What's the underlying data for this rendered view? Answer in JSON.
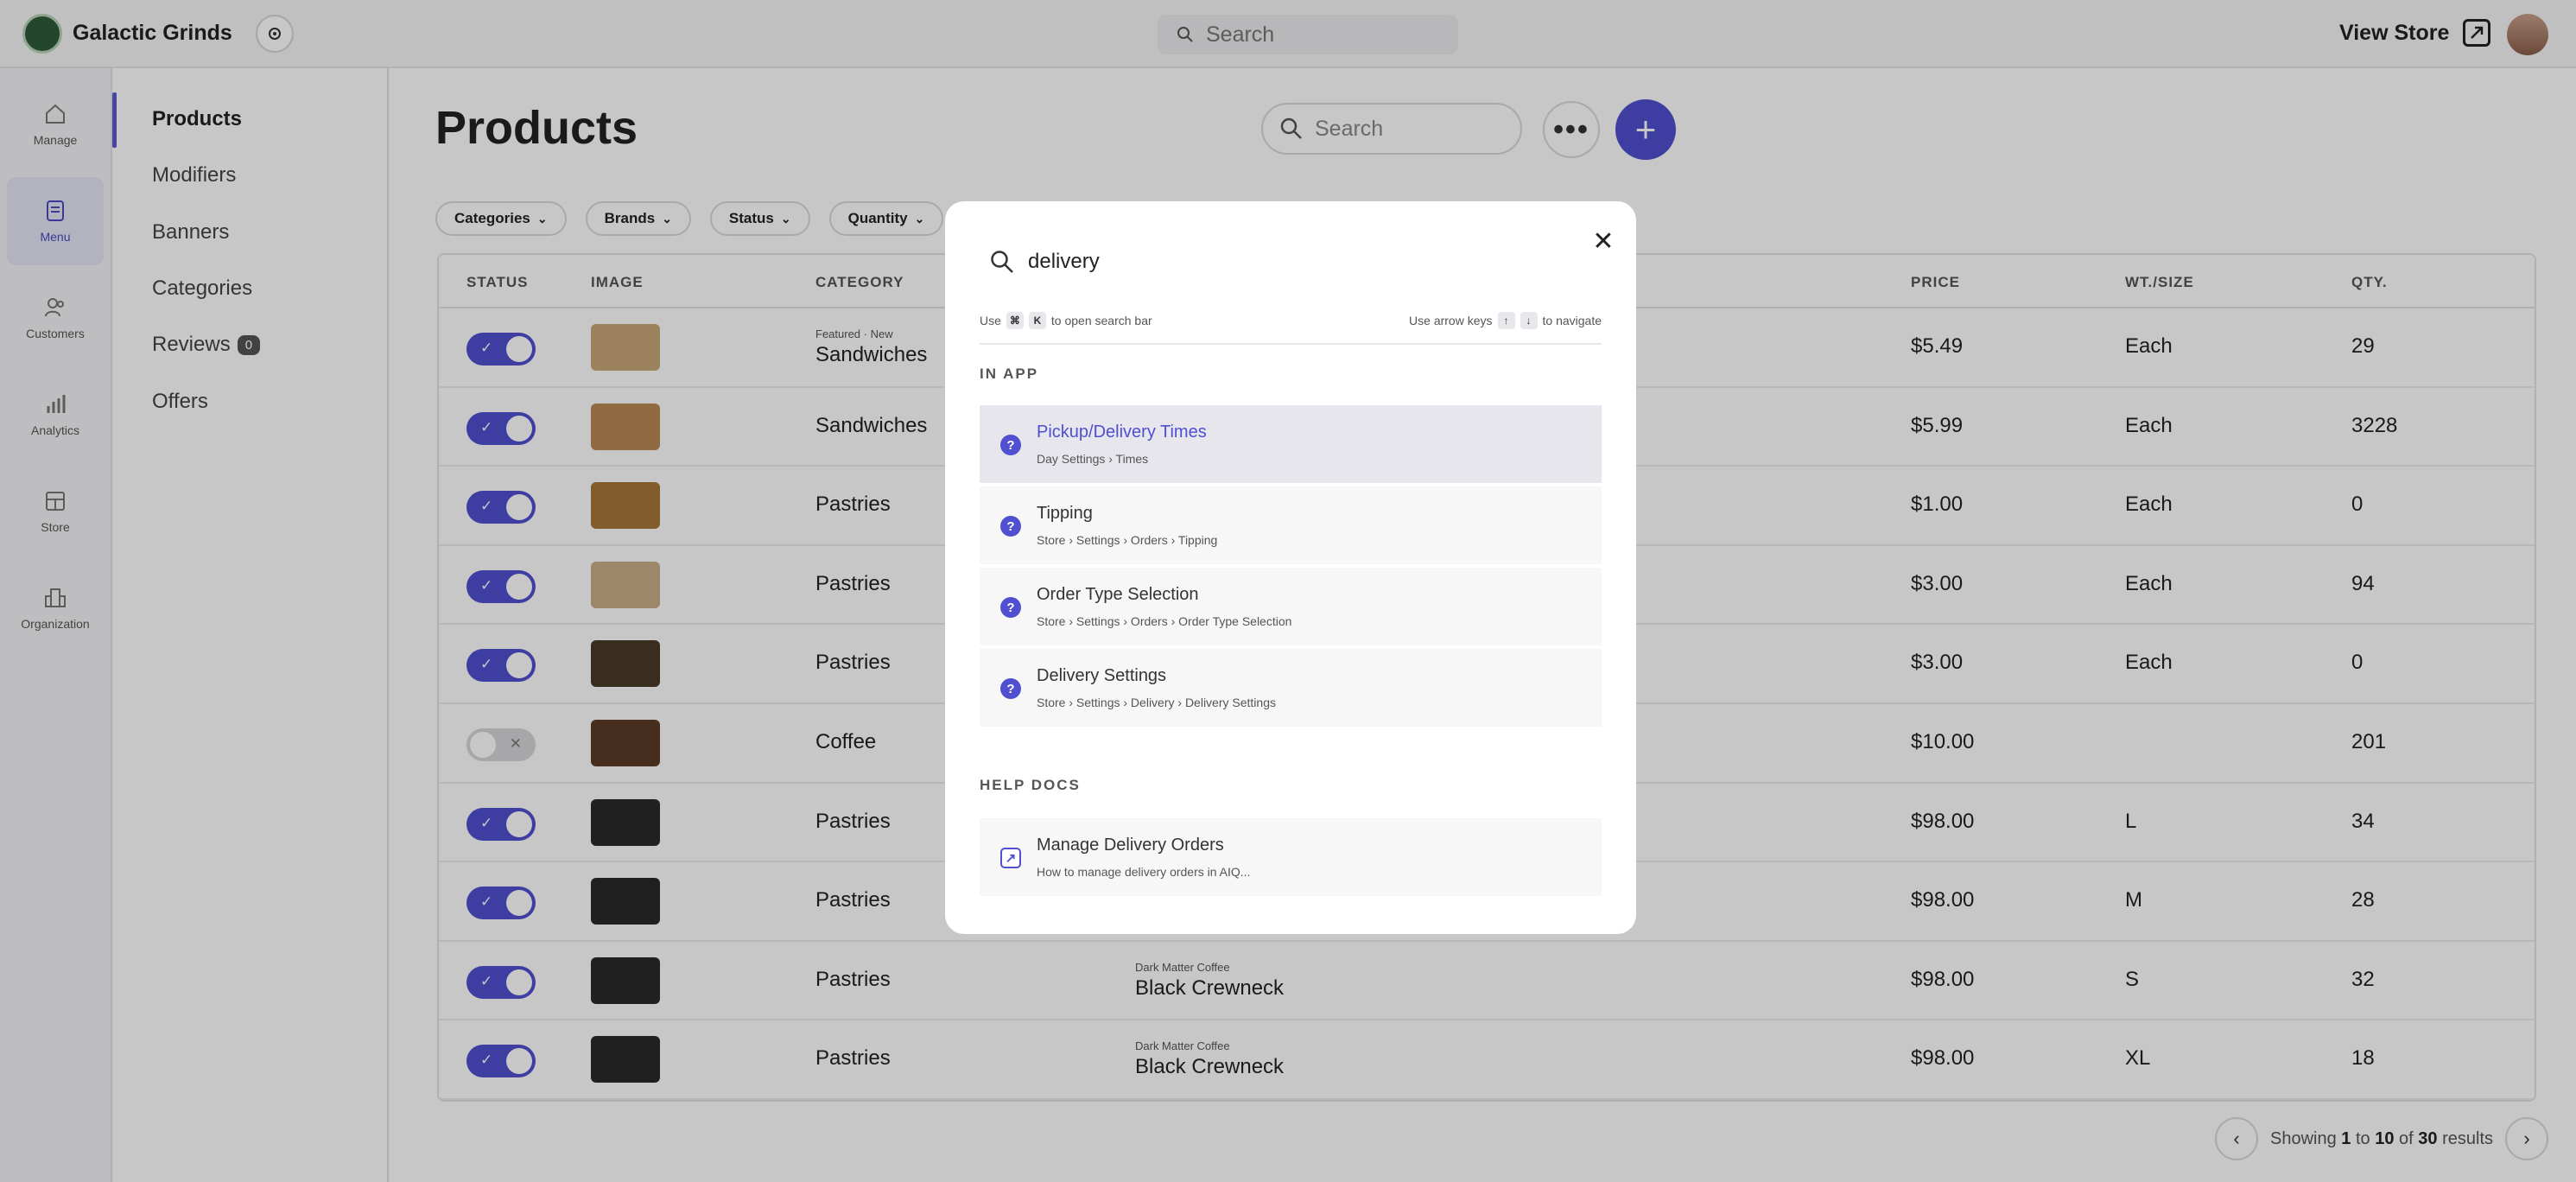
{
  "app": {
    "name": "Galactic Grinds"
  },
  "topbar": {
    "search_placeholder": "Search",
    "view_store_label": "View Store"
  },
  "rail": [
    {
      "label": "Manage",
      "icon": "home-icon"
    },
    {
      "label": "Menu",
      "icon": "menu-icon",
      "active": true
    },
    {
      "label": "Customers",
      "icon": "customers-icon"
    },
    {
      "label": "Analytics",
      "icon": "analytics-icon"
    },
    {
      "label": "Store",
      "icon": "store-icon"
    },
    {
      "label": "Organization",
      "icon": "organization-icon"
    }
  ],
  "subnav": [
    {
      "label": "Products",
      "active": true
    },
    {
      "label": "Modifiers"
    },
    {
      "label": "Banners"
    },
    {
      "label": "Categories"
    },
    {
      "label": "Reviews",
      "badge": "0"
    },
    {
      "label": "Offers"
    }
  ],
  "main": {
    "title": "Products",
    "search_placeholder": "Search",
    "more_label": "•••",
    "add_label": "+",
    "filters": [
      "Categories",
      "Brands",
      "Status",
      "Quantity"
    ],
    "columns": {
      "status": "STATUS",
      "image": "IMAGE",
      "category": "CATEGORY",
      "price": "PRICE",
      "size": "WT./SIZE",
      "qty": "QTY."
    },
    "rows": [
      {
        "enabled": true,
        "category_tag": "Featured · New",
        "category": "Sandwiches",
        "brand": "",
        "name": "",
        "price": "$5.49",
        "size": "Each",
        "qty": "29",
        "thumb": "#c9a878"
      },
      {
        "enabled": true,
        "category_tag": "",
        "category": "Sandwiches",
        "brand": "",
        "name": "",
        "price": "$5.99",
        "size": "Each",
        "qty": "3228",
        "thumb": "#b98a54"
      },
      {
        "enabled": true,
        "category_tag": "",
        "category": "Pastries",
        "brand": "",
        "name": "",
        "price": "$1.00",
        "size": "Each",
        "qty": "0",
        "thumb": "#a8763a"
      },
      {
        "enabled": true,
        "category_tag": "",
        "category": "Pastries",
        "brand": "",
        "name": "",
        "price": "$3.00",
        "size": "Each",
        "qty": "94",
        "thumb": "#c9ad8a"
      },
      {
        "enabled": true,
        "category_tag": "",
        "category": "Pastries",
        "brand": "",
        "name": "",
        "price": "$3.00",
        "size": "Each",
        "qty": "0",
        "thumb": "#4a3a2a"
      },
      {
        "enabled": false,
        "category_tag": "",
        "category": "Coffee",
        "brand": "",
        "name": "",
        "price": "$10.00",
        "size": "",
        "qty": "201",
        "thumb": "#5a3a26"
      },
      {
        "enabled": true,
        "category_tag": "",
        "category": "Pastries",
        "brand": "",
        "name": "",
        "price": "$98.00",
        "size": "L",
        "qty": "34",
        "thumb": "#2a2a2a"
      },
      {
        "enabled": true,
        "category_tag": "",
        "category": "Pastries",
        "brand": "",
        "name": "",
        "price": "$98.00",
        "size": "M",
        "qty": "28",
        "thumb": "#2a2a2a"
      },
      {
        "enabled": true,
        "category_tag": "",
        "category": "Pastries",
        "brand": "Dark Matter Coffee",
        "name": "Black Crewneck",
        "price": "$98.00",
        "size": "S",
        "qty": "32",
        "thumb": "#2a2a2a"
      },
      {
        "enabled": true,
        "category_tag": "",
        "category": "Pastries",
        "brand": "Dark Matter Coffee",
        "name": "Black Crewneck",
        "price": "$98.00",
        "size": "XL",
        "qty": "18",
        "thumb": "#2a2a2a"
      }
    ],
    "pagination": {
      "showing": "Showing",
      "from": "1",
      "to_word": "to",
      "to": "10",
      "of_word": "of",
      "total": "30",
      "results": "results"
    }
  },
  "modal": {
    "query": "delivery",
    "hint_use": "Use",
    "hint_k": "K",
    "hint_open": "to open search bar",
    "hint_arrows": "Use arrow keys",
    "hint_navigate": "to navigate",
    "in_app_title": "IN APP",
    "in_app": [
      {
        "title": "Pickup/Delivery Times",
        "path": "Day Settings › Times",
        "active": true
      },
      {
        "title": "Tipping",
        "path": "Store › Settings › Orders › Tipping"
      },
      {
        "title": "Order Type Selection",
        "path": "Store › Settings › Orders › Order Type Selection"
      },
      {
        "title": "Delivery Settings",
        "path": "Store › Settings › Delivery › Delivery Settings"
      }
    ],
    "help_title": "HELP DOCS",
    "help": [
      {
        "title": "Manage Delivery Orders",
        "path": "How to manage delivery orders in AIQ..."
      }
    ]
  },
  "colors": {
    "accent": "#4f4fd0",
    "toggle_off": "#d6d6da"
  }
}
